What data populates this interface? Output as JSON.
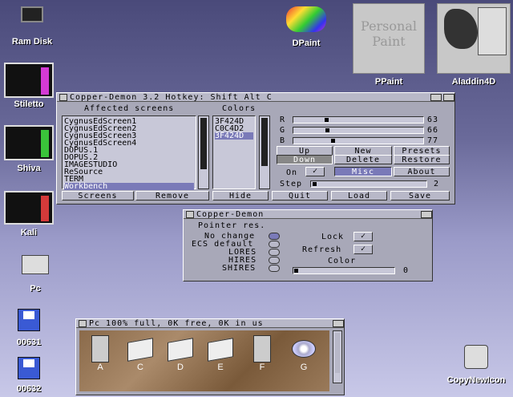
{
  "desktop_icons": {
    "ramdisk": "Ram Disk",
    "dpaint": "DPaint",
    "ppaint": "PPaint",
    "aladdin": "Aladdin4D",
    "stiletto": "Stiletto",
    "shiva": "Shiva",
    "kali": "Kali",
    "pc": "Pc",
    "disk1": "00631",
    "disk2": "00632",
    "copynewicon": "CopyNewIcon"
  },
  "ppaint_preview_text": [
    "Personal",
    "Paint"
  ],
  "copper_main": {
    "title": "Copper-Demon 3.2  Hotkey: Shift Alt C",
    "affected_label": "Affected screens",
    "colors_label": "Colors",
    "screens": [
      "CygnusEdScreen1",
      "CygnusEdScreen2",
      "CygnusEdScreen3",
      "CygnusEdScreen4",
      "DOPUS.1",
      "DOPUS.2",
      "IMAGESTUDIO",
      "ReSource",
      "TERM",
      "Workbench"
    ],
    "colors": [
      "3F424D",
      "C0C4D2",
      "3F424D"
    ],
    "r_label": "R",
    "g_label": "G",
    "b_label": "B",
    "r_value": "63",
    "g_value": "66",
    "b_value": "77",
    "r_level": 63,
    "g_level": 66,
    "b_level": 77,
    "btn_up": "Up",
    "btn_down": "Down",
    "btn_new": "New",
    "btn_delete": "Delete",
    "btn_presets": "Presets",
    "btn_restore": "Restore",
    "on_label": "On",
    "check": "✓",
    "btn_misc": "Misc",
    "btn_about": "About",
    "step_label": "Step",
    "step_value": "2",
    "btn_screens": "Screens",
    "btn_remove": "Remove",
    "btn_hide": "Hide",
    "btn_quit": "Quit",
    "btn_load": "Load",
    "btn_save": "Save"
  },
  "copper_misc": {
    "title": "Copper-Demon",
    "pointer_label": "Pointer res.",
    "options": [
      "No change",
      "ECS default",
      "LORES",
      "HIRES",
      "SHIRES"
    ],
    "lock_label": "Lock",
    "refresh_label": "Refresh",
    "check": "✓",
    "color_label": "Color",
    "color_value": "0"
  },
  "pc_window": {
    "title": "Pc   100% full, 0K free, 0K in us",
    "drives": [
      "A",
      "C",
      "D",
      "E",
      "F",
      "G"
    ]
  }
}
